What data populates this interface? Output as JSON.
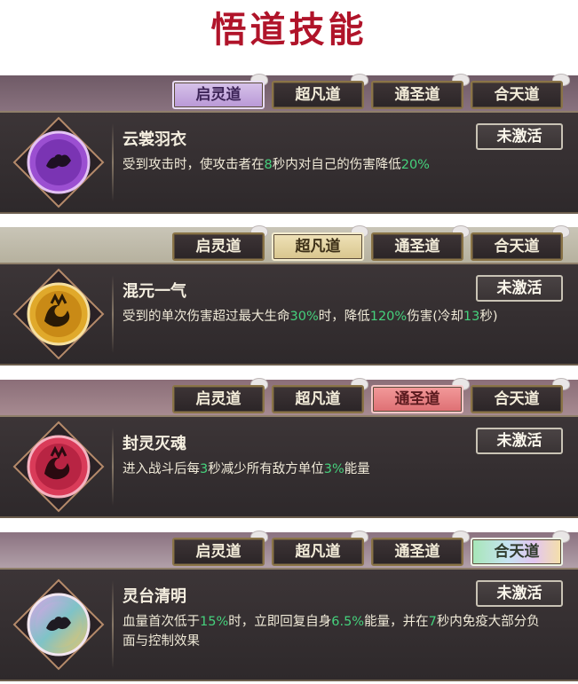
{
  "page_title": "悟道技能",
  "panels": [
    {
      "tabs": [
        "启灵道",
        "超凡道",
        "通圣道",
        "合天道"
      ],
      "active_tab": "启灵道",
      "skill_name": "云裳羽衣",
      "status": "未激活",
      "desc": [
        "受到攻击时，使攻击者在",
        "8",
        "秒内对自己的伤害降低",
        "20%"
      ],
      "emblem_color": "#9b4fd1"
    },
    {
      "tabs": [
        "启灵道",
        "超凡道",
        "通圣道",
        "合天道"
      ],
      "active_tab": "超凡道",
      "skill_name": "混元一气",
      "status": "未激活",
      "desc": [
        "受到的单次伤害超过最大生命",
        "30%",
        "时，降低",
        "120%",
        "伤害(冷却",
        "13",
        "秒)"
      ],
      "emblem_color": "#e0a92b"
    },
    {
      "tabs": [
        "启灵道",
        "超凡道",
        "通圣道",
        "合天道"
      ],
      "active_tab": "通圣道",
      "skill_name": "封灵灭魂",
      "status": "未激活",
      "desc": [
        "进入战斗后每",
        "3",
        "秒减少所有敌方单位",
        "3%",
        "能量"
      ],
      "emblem_color": "#d93b59"
    },
    {
      "tabs": [
        "启灵道",
        "超凡道",
        "通圣道",
        "合天道"
      ],
      "active_tab": "合天道",
      "skill_name": "灵台清明",
      "status": "未激活",
      "desc": [
        "血量首次低于",
        "15%",
        "时，立即回复自身",
        "6.5%",
        "能量，并在",
        "7",
        "秒内免疫大部分负面与控制效果"
      ],
      "emblem_color": "#7fc3c7"
    }
  ]
}
